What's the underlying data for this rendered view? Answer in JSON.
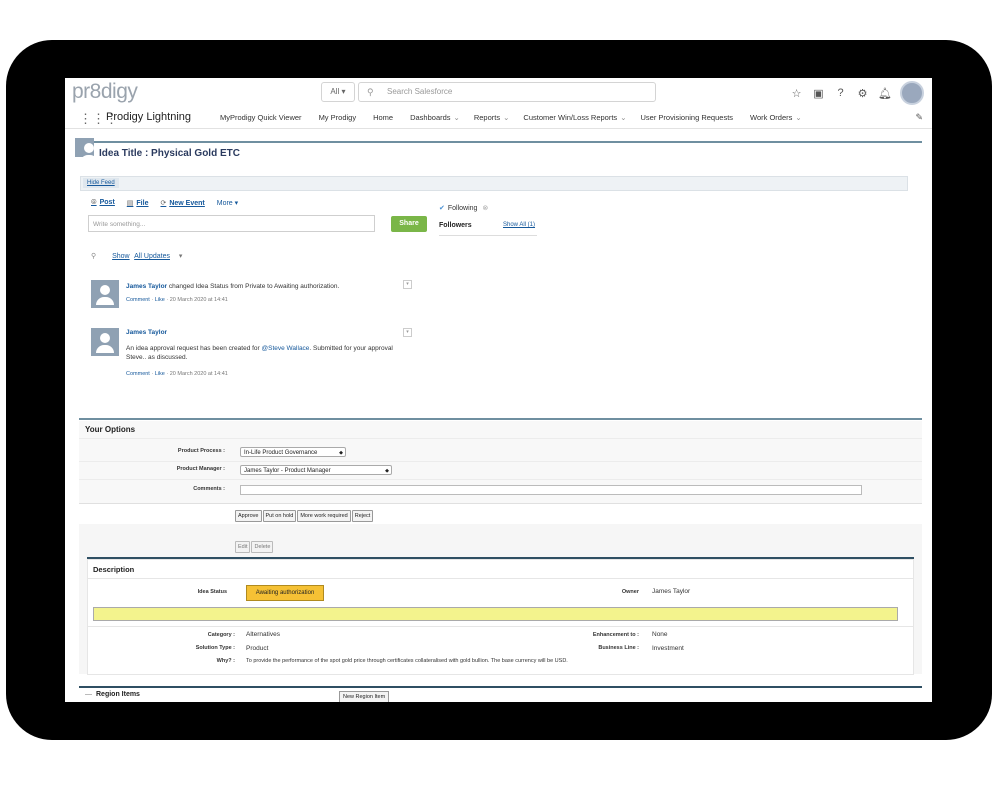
{
  "header": {
    "logo": "pr8digy",
    "search_scope": "All ▾",
    "search_placeholder": "Search Salesforce"
  },
  "nav": {
    "app_name": "Prodigy Lightning",
    "items": [
      {
        "label": "MyProdigy Quick Viewer",
        "chevron": ""
      },
      {
        "label": "My Prodigy",
        "chevron": ""
      },
      {
        "label": "Home",
        "chevron": ""
      },
      {
        "label": "Dashboards",
        "chevron": "⌄"
      },
      {
        "label": "Reports",
        "chevron": "⌄"
      },
      {
        "label": "Customer Win/Loss Reports",
        "chevron": "⌄"
      },
      {
        "label": "User Provisioning Requests",
        "chevron": ""
      },
      {
        "label": "Work Orders",
        "chevron": "⌄"
      }
    ]
  },
  "idea": {
    "title": "Idea Title : Physical Gold ETC"
  },
  "feed": {
    "tab_label": "Hide Feed",
    "publisher": {
      "post": "Post",
      "file": "File",
      "new_event": "New Event",
      "more": "More ▾"
    },
    "input_placeholder": "Write something...",
    "share_label": "Share",
    "following_label": "Following",
    "followers_label": "Followers",
    "show_all": "Show All (1)",
    "filter_show": "Show",
    "filter_all_updates": "All Updates",
    "filter_arrow": "▾",
    "items": [
      {
        "author": "James Taylor",
        "text": " changed Idea Status from Private to Awaiting authorization.",
        "comment": "Comment",
        "like": "Like",
        "time": "20 March 2020 at 14:41"
      },
      {
        "author": "James Taylor",
        "text_before": "An idea approval request has been created for ",
        "mention": "@Steve Wallace",
        "text_after": ". Submitted for your approval Steve.. as discussed.",
        "comment": "Comment",
        "like": "Like",
        "time": "20 March 2020 at 14:41"
      }
    ]
  },
  "options": {
    "heading": "Your Options",
    "product_process_label": "Product Process :",
    "product_process_value": "In-Life Product Governance",
    "product_manager_label": "Product Manager :",
    "product_manager_value": "James Taylor - Product Manager",
    "comments_label": "Comments :",
    "buttons": [
      "Approve",
      "Put on hold",
      "More work required",
      "Reject"
    ]
  },
  "record": {
    "edit": "Edit",
    "delete": "Delete",
    "description_heading": "Description",
    "idea_status_label": "Idea Status",
    "idea_status_value": "Awaiting authorization",
    "owner_label": "Owner",
    "owner_value": "James Taylor",
    "category_label": "Category :",
    "category_value": "Alternatives",
    "enhancement_label": "Enhancement to :",
    "enhancement_value": "None",
    "solution_type_label": "Solution Type :",
    "solution_type_value": "Product",
    "business_line_label": "Business Line :",
    "business_line_value": "Investment",
    "why_label": "Why? :",
    "why_value": "To provide the performance of the spot gold price through certificates collateralised with gold bullion. The base currency will be USD.",
    "region_heading": "Region Items",
    "new_region_button": "New Region Item"
  },
  "colors": {
    "accent_rule": "#6f8fa0",
    "share_green": "#7ab648",
    "status_yellow": "#f5c135",
    "link_blue": "#15589b"
  }
}
